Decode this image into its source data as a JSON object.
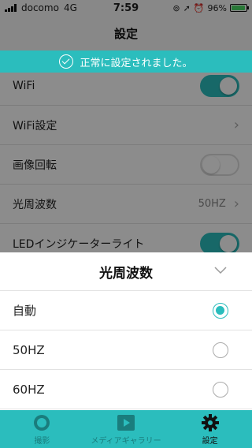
{
  "status_bar": {
    "carrier": "docomo",
    "network": "4G",
    "time": "7:59",
    "battery": "96%",
    "battery_level": 0.96
  },
  "nav": {
    "title": "設定"
  },
  "toast": {
    "message": "正常に設定されました。"
  },
  "settings": {
    "wifi": {
      "label": "WiFi",
      "enabled": true
    },
    "wifi_settings": {
      "label": "WiFi設定"
    },
    "image_rotation": {
      "label": "画像回転",
      "enabled": false
    },
    "light_frequency": {
      "label": "光周波数",
      "value": "50HZ"
    },
    "led_indicator": {
      "label": "LEDインジケーターライト",
      "enabled": true
    }
  },
  "sheet": {
    "title": "光周波数",
    "options": [
      {
        "label": "自動",
        "selected": true
      },
      {
        "label": "50HZ",
        "selected": false
      },
      {
        "label": "60HZ",
        "selected": false
      }
    ]
  },
  "tabs": [
    {
      "label": "撮影",
      "icon": "camera-icon",
      "active": false
    },
    {
      "label": "メディアギャラリー",
      "icon": "play-icon",
      "active": false
    },
    {
      "label": "設定",
      "icon": "gear-icon",
      "active": true
    }
  ],
  "colors": {
    "accent": "#2bbdbd"
  }
}
